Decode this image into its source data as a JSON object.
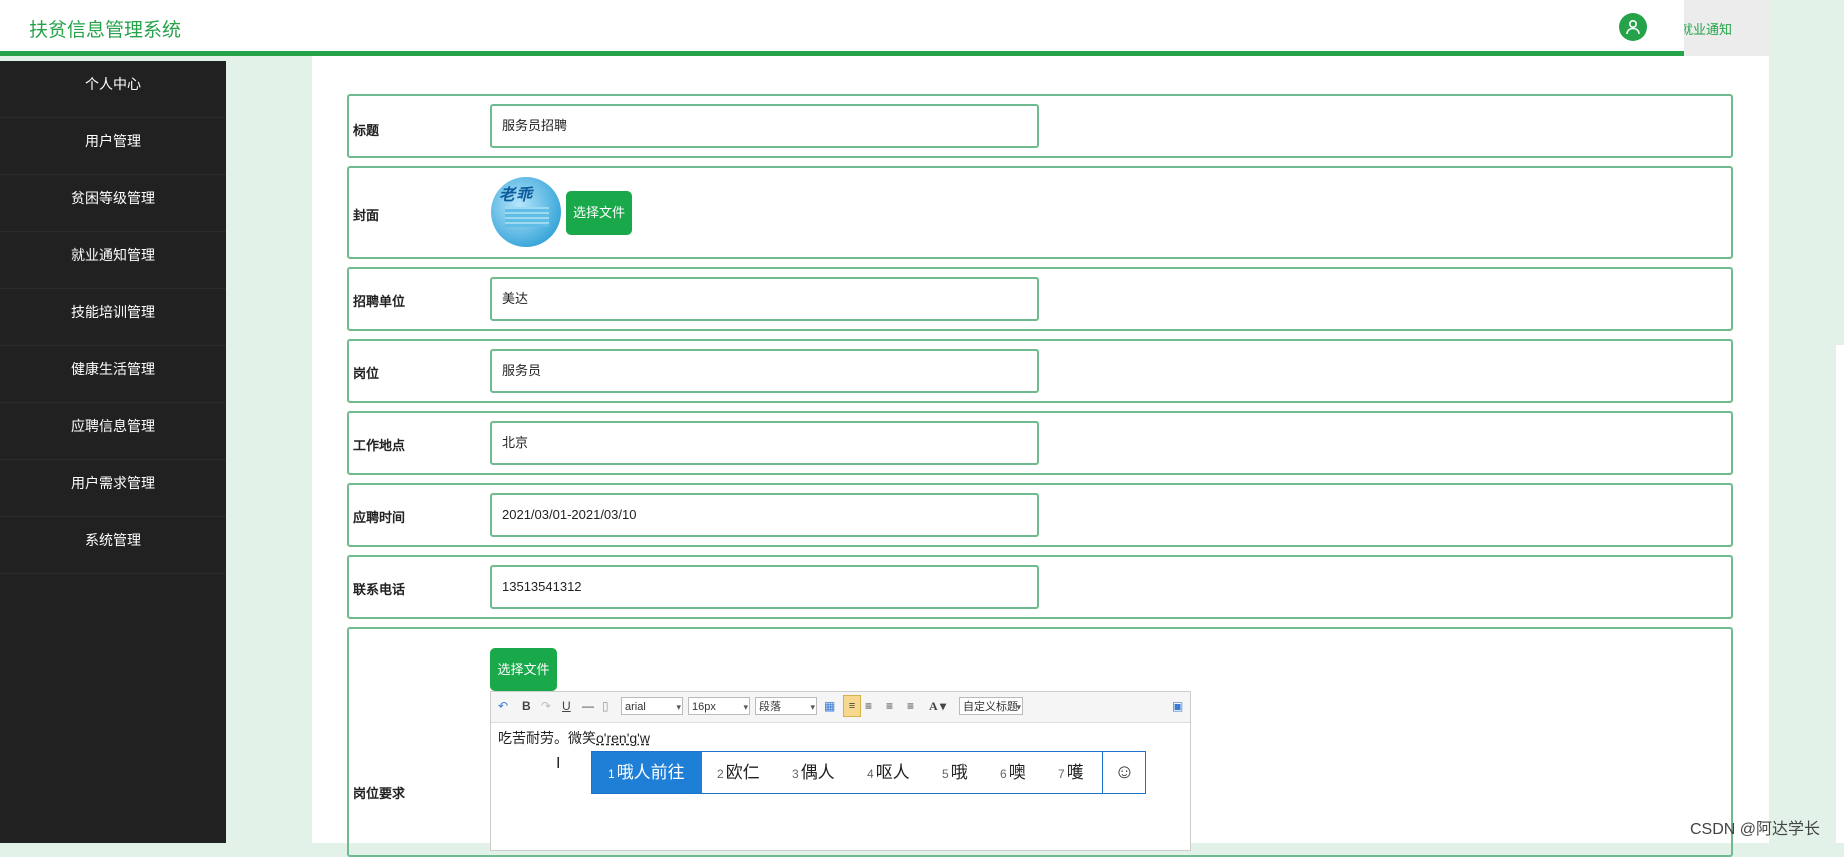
{
  "header": {
    "app_title": "扶贫信息管理系统",
    "active_tab_label": "就业通知",
    "user_icon": "user-icon"
  },
  "sidebar": {
    "items": [
      {
        "label": "个人中心"
      },
      {
        "label": "用户管理"
      },
      {
        "label": "贫困等级管理"
      },
      {
        "label": "就业通知管理"
      },
      {
        "label": "技能培训管理"
      },
      {
        "label": "健康生活管理"
      },
      {
        "label": "应聘信息管理"
      },
      {
        "label": "用户需求管理"
      },
      {
        "label": "系统管理"
      }
    ]
  },
  "form": {
    "title": {
      "label": "标题",
      "value": "服务员招聘"
    },
    "cover": {
      "label": "封面",
      "button_label": "选择文件"
    },
    "company": {
      "label": "招聘单位",
      "value": "美达"
    },
    "position": {
      "label": "岗位",
      "value": "服务员"
    },
    "location": {
      "label": "工作地点",
      "value": "北京"
    },
    "period": {
      "label": "应聘时间",
      "value": "2021/03/01-2021/03/10"
    },
    "phone": {
      "label": "联系电话",
      "value": "13513541312"
    },
    "requirements": {
      "label": "岗位要求",
      "button_label": "选择文件",
      "editor": {
        "font_family": "arial",
        "font_size": "16px",
        "paragraph": "段落",
        "custom_heading": "自定义标题",
        "text": "吃苦耐劳。微笑",
        "composing": "o'ren'g'w"
      }
    }
  },
  "ime": {
    "candidates": [
      {
        "num": "1",
        "text": "哦人前往"
      },
      {
        "num": "2",
        "text": "欧仁"
      },
      {
        "num": "3",
        "text": "偶人"
      },
      {
        "num": "4",
        "text": "呕人"
      },
      {
        "num": "5",
        "text": "哦"
      },
      {
        "num": "6",
        "text": "噢"
      },
      {
        "num": "7",
        "text": "嚄"
      }
    ],
    "emoji": "☺"
  },
  "watermark": "CSDN @阿达学长"
}
